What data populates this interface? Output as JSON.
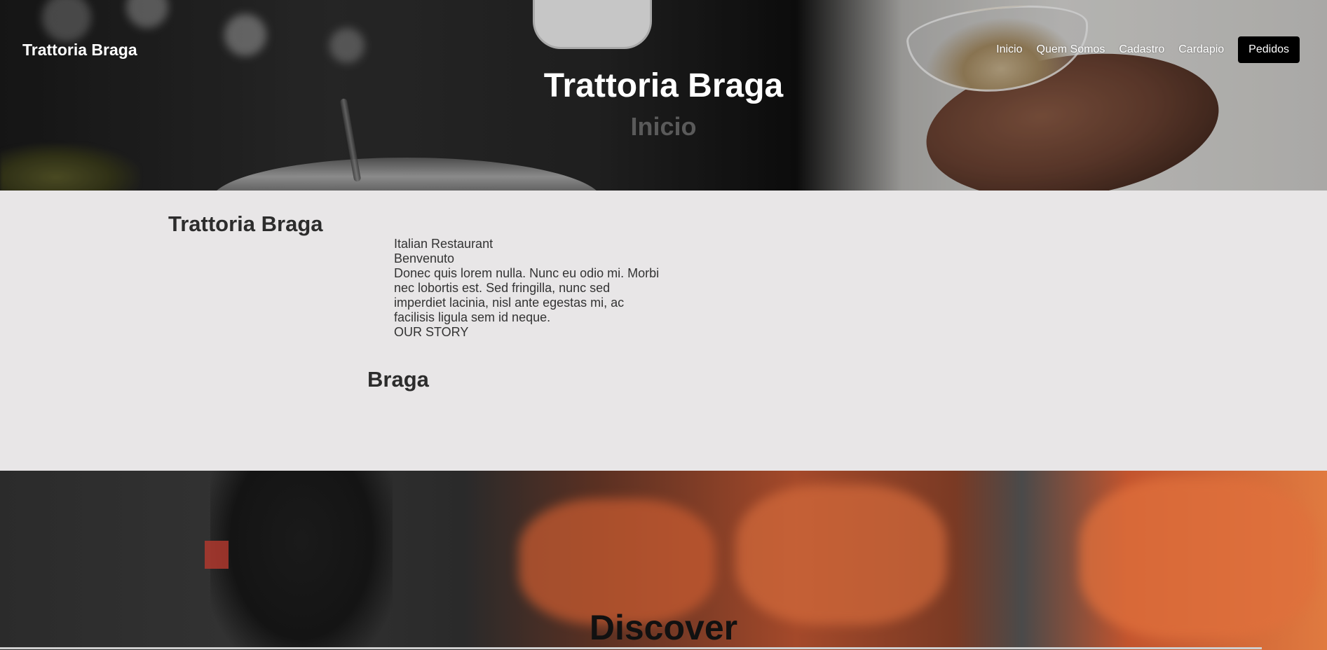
{
  "header": {
    "brand": "Trattoria Braga",
    "nav": [
      "Inicio",
      "Quem Somos",
      "Cadastro",
      "Cardapio"
    ],
    "cta": "Pedidos"
  },
  "hero": {
    "title": "Trattoria Braga",
    "subtitle": "Inicio"
  },
  "about": {
    "title": "Trattoria Braga",
    "lines": [
      "Italian Restaurant",
      "Benvenuto",
      "Donec quis lorem nulla. Nunc eu odio mi. Morbi nec lobortis est. Sed fringilla, nunc sed imperdiet lacinia, nisl ante egestas mi, ac facilisis ligula sem id neque.",
      "OUR STORY"
    ],
    "subtitle": "Braga"
  },
  "discover": {
    "title": "Discover"
  }
}
